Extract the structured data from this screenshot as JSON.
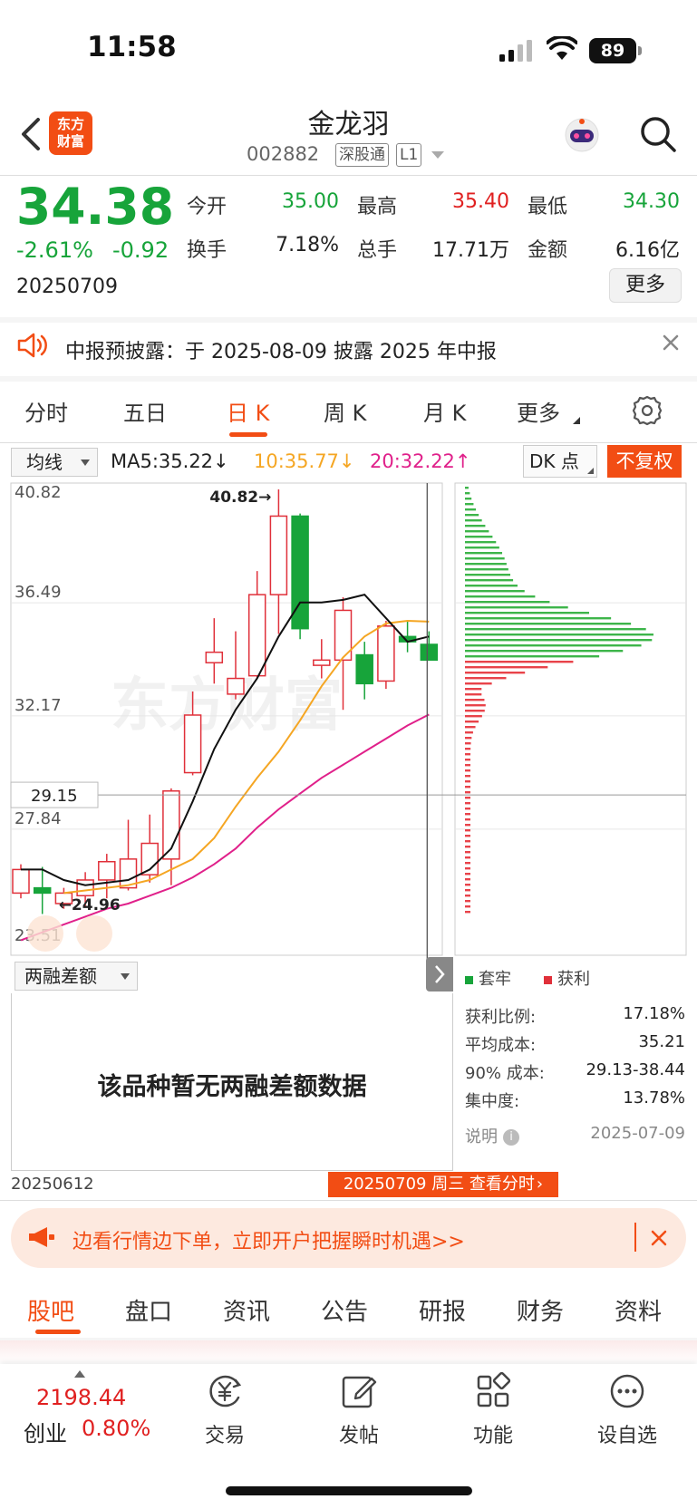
{
  "status_bar": {
    "time": "11:58",
    "battery": "89"
  },
  "header": {
    "logo_text_1": "东方",
    "logo_text_2": "财富",
    "stock_name": "金龙羽",
    "stock_code": "002882",
    "tag_sgt": "深股通",
    "tag_level": "L1"
  },
  "quote": {
    "price": "34.38",
    "change_pct": "-2.61%",
    "change_amt": "-0.92",
    "date": "20250709",
    "open_label": "今开",
    "open": "35.00",
    "high_label": "最高",
    "high": "35.40",
    "low_label": "最低",
    "low": "34.30",
    "turnover_label": "换手",
    "turnover": "7.18%",
    "volume_label": "总手",
    "volume": "17.71万",
    "amount_label": "金额",
    "amount": "6.16亿",
    "more_label": "更多"
  },
  "announcement": {
    "text": "中报预披露：于 2025-08-09 披露 2025 年中报"
  },
  "period_tabs": [
    "分时",
    "五日",
    "日 K",
    "周 K",
    "月 K",
    "更多"
  ],
  "active_period": "日 K",
  "ma_row": {
    "select_label": "均线",
    "ma5": "MA5:35.22",
    "ma10": "10:35.77",
    "ma20": "20:32.22",
    "ma5_arrow": "↓",
    "ma10_arrow": "↓",
    "ma20_arrow": "↑",
    "dk_label": "DK 点",
    "adjust_label": "不复权"
  },
  "chart_data": {
    "type": "candlestick",
    "y_ticks": [
      "40.82",
      "36.49",
      "32.17",
      "27.84",
      "23.51"
    ],
    "ylim": [
      23.51,
      40.82
    ],
    "crosshair_price": "29.15",
    "max_label": "40.82→",
    "min_label": "←24.96",
    "watermark": "东方财富",
    "colors": {
      "up": "#e0303a",
      "down": "#17a43a",
      "ma5": "#111111",
      "ma10": "#f5a623",
      "ma20": "#e0208a"
    },
    "candles": [
      {
        "o": 25.4,
        "c": 26.3,
        "h": 26.5,
        "l": 25.2
      },
      {
        "o": 25.6,
        "c": 25.4,
        "h": 26.4,
        "l": 24.6
      },
      {
        "o": 25.0,
        "c": 25.4,
        "h": 25.6,
        "l": 24.8
      },
      {
        "o": 25.3,
        "c": 25.9,
        "h": 26.2,
        "l": 24.9
      },
      {
        "o": 25.9,
        "c": 26.6,
        "h": 26.9,
        "l": 25.2
      },
      {
        "o": 25.6,
        "c": 26.7,
        "h": 28.2,
        "l": 25.5
      },
      {
        "o": 26.1,
        "c": 27.3,
        "h": 28.4,
        "l": 25.8
      },
      {
        "o": 26.7,
        "c": 29.3,
        "h": 29.4,
        "l": 25.7
      },
      {
        "o": 30.0,
        "c": 32.2,
        "h": 33.1,
        "l": 29.9
      },
      {
        "o": 34.2,
        "c": 34.6,
        "h": 35.9,
        "l": 33.4
      },
      {
        "o": 33.0,
        "c": 33.6,
        "h": 35.4,
        "l": 32.8
      },
      {
        "o": 33.7,
        "c": 36.8,
        "h": 37.7,
        "l": 33.6
      },
      {
        "o": 36.8,
        "c": 39.8,
        "h": 40.82,
        "l": 35.3
      },
      {
        "o": 39.8,
        "c": 35.5,
        "h": 39.9,
        "l": 35.1
      },
      {
        "o": 34.1,
        "c": 34.3,
        "h": 35.1,
        "l": 33.6
      },
      {
        "o": 34.3,
        "c": 36.2,
        "h": 36.7,
        "l": 32.4
      },
      {
        "o": 34.5,
        "c": 33.4,
        "h": 35.0,
        "l": 32.8
      },
      {
        "o": 33.5,
        "c": 35.6,
        "h": 35.8,
        "l": 33.2
      },
      {
        "o": 35.2,
        "c": 35.0,
        "h": 35.8,
        "l": 34.6
      },
      {
        "o": 34.9,
        "c": 34.3,
        "h": 35.4,
        "l": 34.3
      }
    ],
    "ma5": [
      26.3,
      26.3,
      25.9,
      25.7,
      25.8,
      25.9,
      26.3,
      27.1,
      28.9,
      30.9,
      32.4,
      33.6,
      35.2,
      36.5,
      36.5,
      36.6,
      36.8,
      35.9,
      35.0,
      35.2
    ],
    "ma10": [
      25.4,
      25.5,
      25.6,
      25.7,
      25.9,
      26.3,
      26.7,
      27.5,
      28.7,
      29.8,
      30.8,
      32.0,
      33.3,
      34.4,
      35.2,
      35.7,
      35.8,
      35.77
    ],
    "ma20": [
      23.6,
      23.9,
      24.2,
      24.5,
      24.8,
      25.0,
      25.3,
      25.6,
      26.0,
      26.5,
      27.1,
      27.9,
      28.6,
      29.2,
      29.8,
      30.3,
      30.8,
      31.3,
      31.8,
      32.22
    ]
  },
  "chip_distribution": {
    "legend_loss": "套牢",
    "legend_profit": "获利",
    "profit_ratio_label": "获利比例:",
    "profit_ratio": "17.18%",
    "avg_cost_label": "平均成本:",
    "avg_cost": "35.21",
    "cost90_label": "90% 成本:",
    "cost90": "29.13-38.44",
    "concentration_label": "集中度:",
    "concentration": "13.78%",
    "explain_label": "说明",
    "date": "2025-07-09"
  },
  "lower_panel": {
    "select_label": "两融差额",
    "no_data": "该品种暂无两融差额数据",
    "start_date": "20250612",
    "current_date": "20250709 周三 查看分时"
  },
  "promo": {
    "text": "边看行情边下单，立即开户把握瞬时机遇>>"
  },
  "section_tabs": [
    "股吧",
    "盘口",
    "资讯",
    "公告",
    "研报",
    "财务",
    "资料"
  ],
  "bottom_bar": {
    "index_value": "2198.44",
    "index_name": "创业",
    "index_pct": "0.80%",
    "nav": [
      "交易",
      "发帖",
      "功能",
      "设自选"
    ]
  }
}
